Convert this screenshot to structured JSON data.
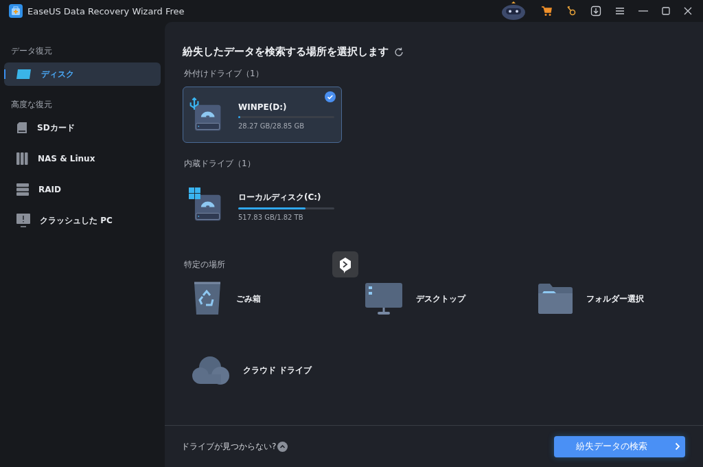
{
  "window": {
    "title": "EaseUS Data Recovery Wizard Free"
  },
  "sidebar": {
    "sections": [
      {
        "heading": "データ復元",
        "items": [
          {
            "label": "ディスク",
            "kind": "disk",
            "selected": true
          }
        ]
      },
      {
        "heading": "高度な復元",
        "items": [
          {
            "label": "SDカード",
            "kind": "sd",
            "selected": false
          },
          {
            "label": "NAS & Linux",
            "kind": "nas",
            "selected": false
          },
          {
            "label": "RAID",
            "kind": "raid",
            "selected": false
          },
          {
            "label": "クラッシュした PC",
            "kind": "pc",
            "selected": false
          }
        ]
      }
    ]
  },
  "main": {
    "title": "紛失したデータを検索する場所を選択します",
    "drive_groups": [
      {
        "heading": "外付けドライブ（1）",
        "drives": [
          {
            "name": "WINPE(D:)",
            "usage": "28.27 GB/28.85 GB",
            "level": 0.02,
            "kind": "usb",
            "selected": true
          }
        ]
      },
      {
        "heading": "内蔵ドライブ（1）",
        "drives": [
          {
            "name": "ローカルディスク(C:)",
            "usage": "517.83 GB/1.82 TB",
            "level": 0.7,
            "kind": "windows",
            "selected": false
          }
        ]
      }
    ],
    "locations": {
      "heading": "特定の場所",
      "items": [
        {
          "label": "ごみ箱",
          "kind": "trash"
        },
        {
          "label": "デスクトップ",
          "kind": "desktop"
        },
        {
          "label": "フォルダー選択",
          "kind": "folder"
        },
        {
          "label": "クラウド ドライブ",
          "kind": "cloud"
        }
      ]
    }
  },
  "footer": {
    "hint": "ドライブが見つからない?",
    "button": "紛失データの検索"
  }
}
